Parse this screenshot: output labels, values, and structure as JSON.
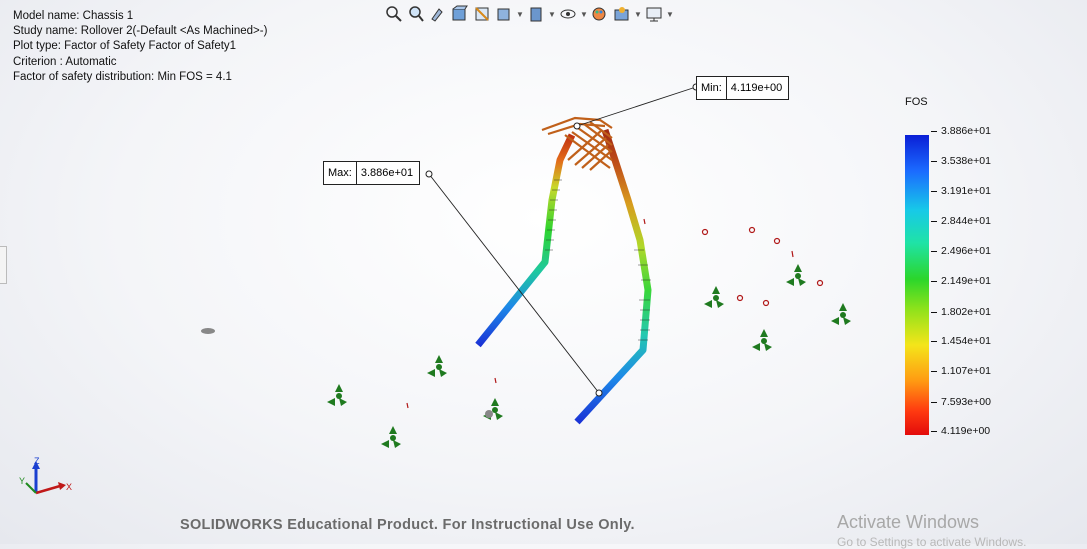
{
  "info": {
    "model_name": "Model name: Chassis 1",
    "study_name": "Study name: Rollover 2(-Default <As Machined>-)",
    "plot_type": "Plot type: Factor of Safety Factor of Safety1",
    "criterion": "Criterion : Automatic",
    "distribution": "Factor of safety distribution: Min FOS = 4.1"
  },
  "toolbar": {
    "icons": [
      "zoom-to-fit-icon",
      "zoom-to-area-icon",
      "previous-view-icon",
      "section-view-icon",
      "view-orientation-icon",
      "display-style-icon",
      "hide-show-items-icon",
      "edit-appearance-icon",
      "apply-scene-icon",
      "view-settings-icon"
    ]
  },
  "callouts": {
    "min": {
      "label": "Min:",
      "value": "4.119e+00"
    },
    "max": {
      "label": "Max:",
      "value": "3.886e+01"
    }
  },
  "legend": {
    "title": "FOS",
    "ticks": [
      "3.886e+01",
      "3.538e+01",
      "3.191e+01",
      "2.844e+01",
      "2.496e+01",
      "2.149e+01",
      "1.802e+01",
      "1.454e+01",
      "1.107e+01",
      "7.593e+00",
      "4.119e+00"
    ],
    "colors": {
      "max": "#0a1fd6",
      "min": "#e30b0b"
    }
  },
  "triad": {
    "x": "X",
    "y": "Y",
    "z": "Z"
  },
  "watermark": "SOLIDWORKS Educational Product. For Instructional Use Only.",
  "windows": {
    "title": "Activate Windows",
    "subtitle": "Go to Settings to activate Windows."
  }
}
